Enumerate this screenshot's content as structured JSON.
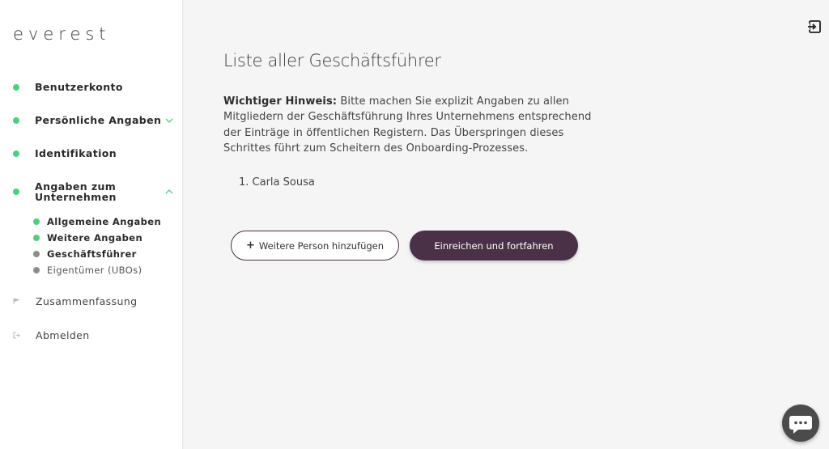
{
  "sidebar": {
    "logo": "everest",
    "items": [
      {
        "label": "Benutzerkonto"
      },
      {
        "label": "Persönliche Angaben"
      },
      {
        "label": "Identifikation"
      },
      {
        "label": "Angaben zum Unternehmen"
      }
    ],
    "sub_items": [
      {
        "label": "Allgemeine Angaben",
        "status": "done"
      },
      {
        "label": "Weitere Angaben",
        "status": "done"
      },
      {
        "label": "Geschäftsführer",
        "status": "current"
      },
      {
        "label": "Eigentümer (UBOs)",
        "status": "pending"
      }
    ],
    "summary_label": "Zusammenfassung",
    "logout_label": "Abmelden"
  },
  "main": {
    "title": "Liste aller Geschäftsführer",
    "hint_bold": "Wichtiger Hinweis:",
    "hint_text": " Bitte machen Sie explizit Angaben zu allen Mitgliedern der Geschäftsführung Ihres Unternehmens entsprechend der Einträge in öffentlichen Registern. Das Überspringen dieses Schrittes führt zum Scheitern des Onboarding-Prozesses.",
    "persons": [
      "1. Carla Sousa"
    ],
    "add_button": "Weitere Person hinzufügen",
    "submit_button": "Einreichen und fortfahren"
  },
  "colors": {
    "accent": "#4a3147",
    "done": "#4cd07d",
    "pending": "#8c8c8c",
    "background": "#f5f5f5"
  },
  "icons": {
    "exit": "exit-icon",
    "chat": "chat-icon",
    "flag": "flag-icon",
    "logout": "logout-icon"
  }
}
